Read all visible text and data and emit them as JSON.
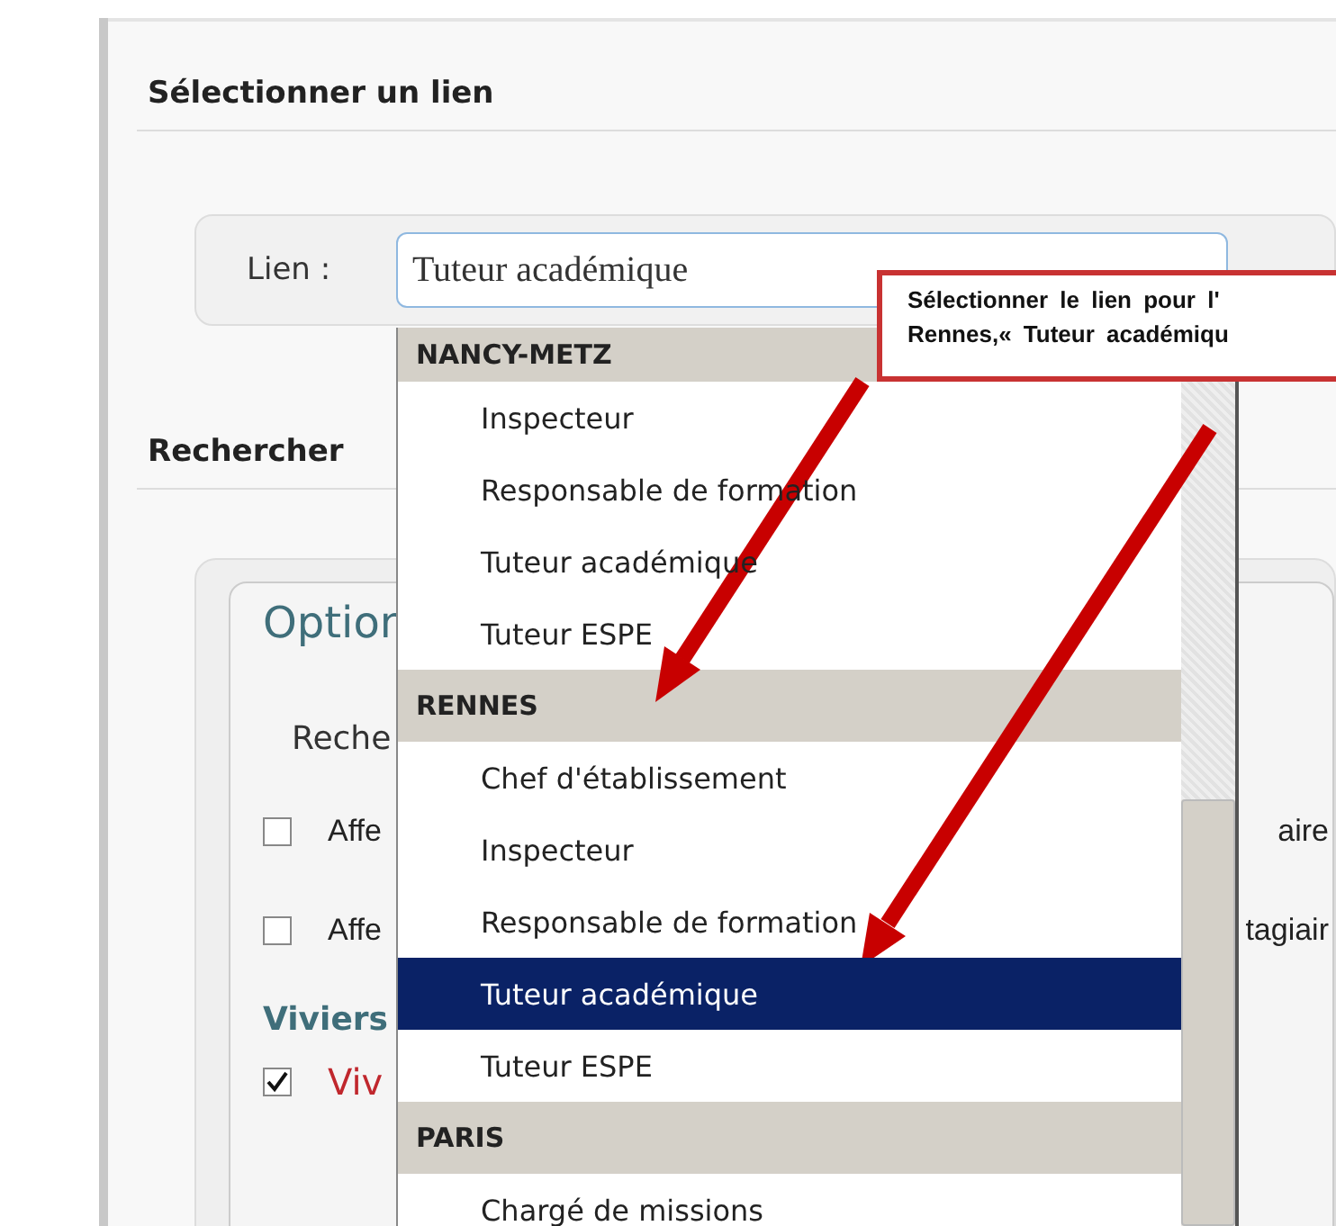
{
  "section_title": "Sélectionner un lien",
  "link_field": {
    "label": "Lien :",
    "value": "Tuteur académique"
  },
  "search_title": "Rechercher",
  "options": {
    "legend": "Option",
    "search_label": "Reche",
    "checkboxes": [
      {
        "label": "Affe",
        "label_end": "aire",
        "checked": false
      },
      {
        "label": "Affe",
        "label_end": "tagiair",
        "checked": false
      }
    ],
    "viviers_title": "Viviers",
    "viviers": [
      {
        "label": "Viv",
        "checked": true
      }
    ]
  },
  "dropdown": {
    "groups": [
      {
        "label": "NANCY-METZ",
        "items": [
          {
            "label": "Inspecteur",
            "selected": false
          },
          {
            "label": "Responsable de formation",
            "selected": false
          },
          {
            "label": "Tuteur académique",
            "selected": false
          },
          {
            "label": "Tuteur ESPE",
            "selected": false
          }
        ]
      },
      {
        "label": "RENNES",
        "items": [
          {
            "label": "Chef d'établissement",
            "selected": false
          },
          {
            "label": "Inspecteur",
            "selected": false
          },
          {
            "label": "Responsable de formation",
            "selected": false
          },
          {
            "label": "Tuteur académique",
            "selected": true
          },
          {
            "label": "Tuteur ESPE",
            "selected": false
          }
        ]
      },
      {
        "label": "PARIS",
        "items": [
          {
            "label": "Chargé de missions",
            "selected": false
          }
        ]
      }
    ]
  },
  "callout": {
    "lines": [
      "Sélectionner le lien pour l'",
      "Rennes,« Tuteur académiqu"
    ]
  }
}
